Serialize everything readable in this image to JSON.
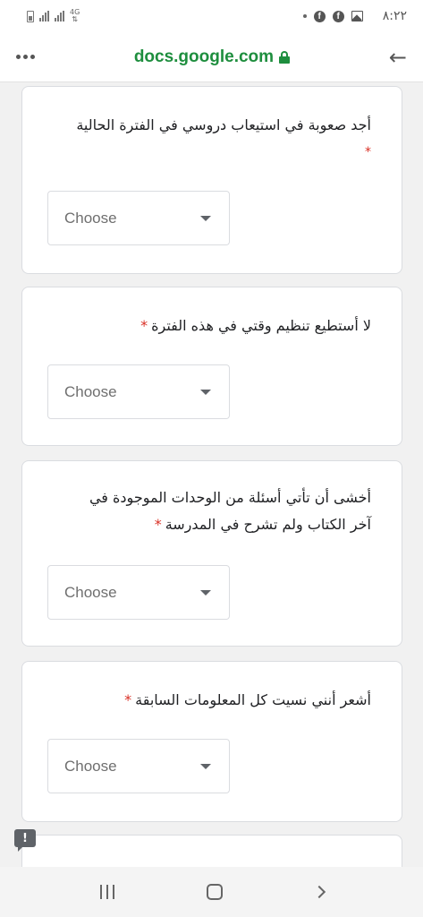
{
  "status_bar": {
    "network_type": "4G",
    "time": "٨:٢٢",
    "icons": [
      "battery-icon",
      "signal-icon",
      "facebook-icon",
      "facebook-icon",
      "gallery-icon"
    ]
  },
  "browser": {
    "url": "docs.google.com",
    "menu_icon": "more-horizontal-icon",
    "back_icon": "arrow-back-icon"
  },
  "questions": [
    {
      "text": "أجد صعوبة في استيعاب دروسي في الفترة الحالية",
      "required_mark": "*",
      "dropdown_value": "Choose"
    },
    {
      "text": "لا أستطيع تنظيم وقتي في هذه الفترة",
      "required_mark": "*",
      "dropdown_value": "Choose"
    },
    {
      "line1": "أخشى أن تأتي أسئلة من الوحدات الموجودة في",
      "line2": "آخر الكتاب ولم تشرح في المدرسة",
      "required_mark": "*",
      "dropdown_value": "Choose"
    },
    {
      "text": "أشعر أنني نسيت كل المعلومات السابقة",
      "required_mark": "*",
      "dropdown_value": "Choose"
    }
  ],
  "feedback": {
    "label": "!"
  },
  "nav_bar": {
    "icons": [
      "recents-icon",
      "home-icon",
      "back-icon"
    ]
  }
}
